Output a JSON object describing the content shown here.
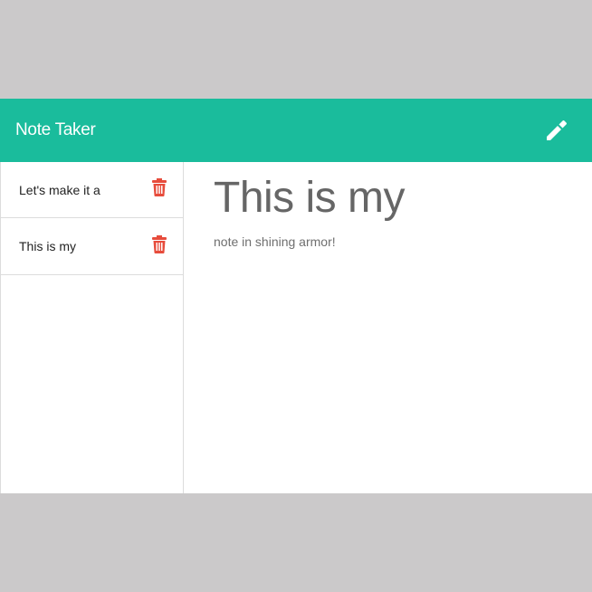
{
  "navbar": {
    "title": "Note Taker",
    "new_note_icon": "pencil-icon",
    "color": "#1abc9c"
  },
  "sidebar": {
    "notes": [
      {
        "title": "Let's make it a",
        "delete_icon": "trash-icon"
      },
      {
        "title": "This is my",
        "delete_icon": "trash-icon"
      }
    ]
  },
  "editor": {
    "title": "This is my",
    "text": "note in shining armor!"
  },
  "colors": {
    "accent": "#1abc9c",
    "delete": "#e74c3c",
    "backdrop": "#cbc9ca"
  }
}
